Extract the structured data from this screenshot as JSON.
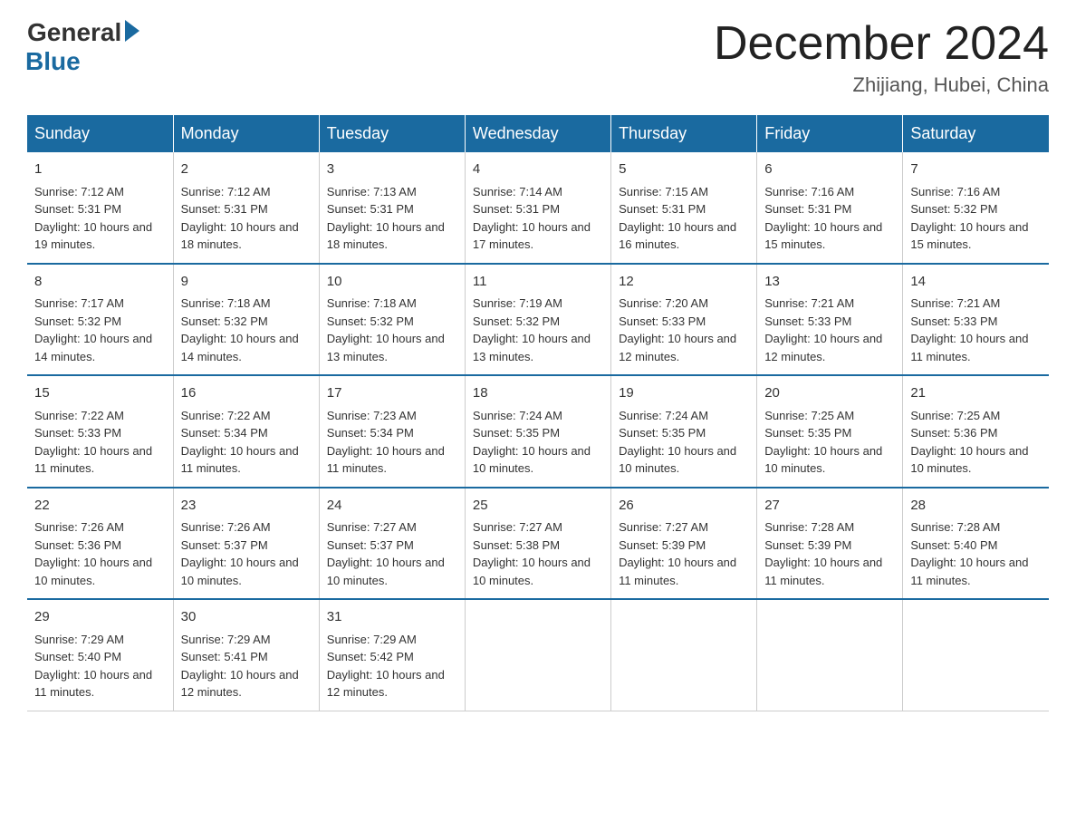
{
  "logo": {
    "general": "General",
    "blue": "Blue"
  },
  "title": "December 2024",
  "location": "Zhijiang, Hubei, China",
  "days_header": [
    "Sunday",
    "Monday",
    "Tuesday",
    "Wednesday",
    "Thursday",
    "Friday",
    "Saturday"
  ],
  "weeks": [
    [
      {
        "day": "1",
        "sunrise": "Sunrise: 7:12 AM",
        "sunset": "Sunset: 5:31 PM",
        "daylight": "Daylight: 10 hours and 19 minutes."
      },
      {
        "day": "2",
        "sunrise": "Sunrise: 7:12 AM",
        "sunset": "Sunset: 5:31 PM",
        "daylight": "Daylight: 10 hours and 18 minutes."
      },
      {
        "day": "3",
        "sunrise": "Sunrise: 7:13 AM",
        "sunset": "Sunset: 5:31 PM",
        "daylight": "Daylight: 10 hours and 18 minutes."
      },
      {
        "day": "4",
        "sunrise": "Sunrise: 7:14 AM",
        "sunset": "Sunset: 5:31 PM",
        "daylight": "Daylight: 10 hours and 17 minutes."
      },
      {
        "day": "5",
        "sunrise": "Sunrise: 7:15 AM",
        "sunset": "Sunset: 5:31 PM",
        "daylight": "Daylight: 10 hours and 16 minutes."
      },
      {
        "day": "6",
        "sunrise": "Sunrise: 7:16 AM",
        "sunset": "Sunset: 5:31 PM",
        "daylight": "Daylight: 10 hours and 15 minutes."
      },
      {
        "day": "7",
        "sunrise": "Sunrise: 7:16 AM",
        "sunset": "Sunset: 5:32 PM",
        "daylight": "Daylight: 10 hours and 15 minutes."
      }
    ],
    [
      {
        "day": "8",
        "sunrise": "Sunrise: 7:17 AM",
        "sunset": "Sunset: 5:32 PM",
        "daylight": "Daylight: 10 hours and 14 minutes."
      },
      {
        "day": "9",
        "sunrise": "Sunrise: 7:18 AM",
        "sunset": "Sunset: 5:32 PM",
        "daylight": "Daylight: 10 hours and 14 minutes."
      },
      {
        "day": "10",
        "sunrise": "Sunrise: 7:18 AM",
        "sunset": "Sunset: 5:32 PM",
        "daylight": "Daylight: 10 hours and 13 minutes."
      },
      {
        "day": "11",
        "sunrise": "Sunrise: 7:19 AM",
        "sunset": "Sunset: 5:32 PM",
        "daylight": "Daylight: 10 hours and 13 minutes."
      },
      {
        "day": "12",
        "sunrise": "Sunrise: 7:20 AM",
        "sunset": "Sunset: 5:33 PM",
        "daylight": "Daylight: 10 hours and 12 minutes."
      },
      {
        "day": "13",
        "sunrise": "Sunrise: 7:21 AM",
        "sunset": "Sunset: 5:33 PM",
        "daylight": "Daylight: 10 hours and 12 minutes."
      },
      {
        "day": "14",
        "sunrise": "Sunrise: 7:21 AM",
        "sunset": "Sunset: 5:33 PM",
        "daylight": "Daylight: 10 hours and 11 minutes."
      }
    ],
    [
      {
        "day": "15",
        "sunrise": "Sunrise: 7:22 AM",
        "sunset": "Sunset: 5:33 PM",
        "daylight": "Daylight: 10 hours and 11 minutes."
      },
      {
        "day": "16",
        "sunrise": "Sunrise: 7:22 AM",
        "sunset": "Sunset: 5:34 PM",
        "daylight": "Daylight: 10 hours and 11 minutes."
      },
      {
        "day": "17",
        "sunrise": "Sunrise: 7:23 AM",
        "sunset": "Sunset: 5:34 PM",
        "daylight": "Daylight: 10 hours and 11 minutes."
      },
      {
        "day": "18",
        "sunrise": "Sunrise: 7:24 AM",
        "sunset": "Sunset: 5:35 PM",
        "daylight": "Daylight: 10 hours and 10 minutes."
      },
      {
        "day": "19",
        "sunrise": "Sunrise: 7:24 AM",
        "sunset": "Sunset: 5:35 PM",
        "daylight": "Daylight: 10 hours and 10 minutes."
      },
      {
        "day": "20",
        "sunrise": "Sunrise: 7:25 AM",
        "sunset": "Sunset: 5:35 PM",
        "daylight": "Daylight: 10 hours and 10 minutes."
      },
      {
        "day": "21",
        "sunrise": "Sunrise: 7:25 AM",
        "sunset": "Sunset: 5:36 PM",
        "daylight": "Daylight: 10 hours and 10 minutes."
      }
    ],
    [
      {
        "day": "22",
        "sunrise": "Sunrise: 7:26 AM",
        "sunset": "Sunset: 5:36 PM",
        "daylight": "Daylight: 10 hours and 10 minutes."
      },
      {
        "day": "23",
        "sunrise": "Sunrise: 7:26 AM",
        "sunset": "Sunset: 5:37 PM",
        "daylight": "Daylight: 10 hours and 10 minutes."
      },
      {
        "day": "24",
        "sunrise": "Sunrise: 7:27 AM",
        "sunset": "Sunset: 5:37 PM",
        "daylight": "Daylight: 10 hours and 10 minutes."
      },
      {
        "day": "25",
        "sunrise": "Sunrise: 7:27 AM",
        "sunset": "Sunset: 5:38 PM",
        "daylight": "Daylight: 10 hours and 10 minutes."
      },
      {
        "day": "26",
        "sunrise": "Sunrise: 7:27 AM",
        "sunset": "Sunset: 5:39 PM",
        "daylight": "Daylight: 10 hours and 11 minutes."
      },
      {
        "day": "27",
        "sunrise": "Sunrise: 7:28 AM",
        "sunset": "Sunset: 5:39 PM",
        "daylight": "Daylight: 10 hours and 11 minutes."
      },
      {
        "day": "28",
        "sunrise": "Sunrise: 7:28 AM",
        "sunset": "Sunset: 5:40 PM",
        "daylight": "Daylight: 10 hours and 11 minutes."
      }
    ],
    [
      {
        "day": "29",
        "sunrise": "Sunrise: 7:29 AM",
        "sunset": "Sunset: 5:40 PM",
        "daylight": "Daylight: 10 hours and 11 minutes."
      },
      {
        "day": "30",
        "sunrise": "Sunrise: 7:29 AM",
        "sunset": "Sunset: 5:41 PM",
        "daylight": "Daylight: 10 hours and 12 minutes."
      },
      {
        "day": "31",
        "sunrise": "Sunrise: 7:29 AM",
        "sunset": "Sunset: 5:42 PM",
        "daylight": "Daylight: 10 hours and 12 minutes."
      },
      null,
      null,
      null,
      null
    ]
  ]
}
